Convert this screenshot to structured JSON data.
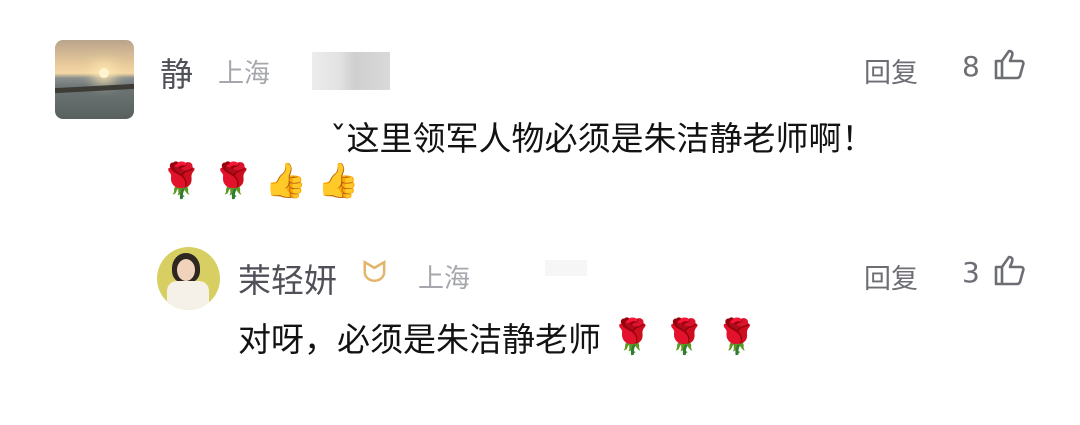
{
  "comment": {
    "username": "静",
    "location": "上海",
    "text": "这里领军人物必须是朱洁静老师啊！",
    "prefix": "ˇ",
    "emojis": [
      "🌹",
      "🌹",
      "👍",
      "👍"
    ],
    "reply_label": "回复",
    "like_count": "8"
  },
  "reply": {
    "username": "茉轻妍",
    "badge": "ᗢ",
    "location": "上海",
    "text": "对呀，必须是朱洁静老师",
    "emojis": [
      "🌹",
      "🌹",
      "🌹"
    ],
    "reply_label": "回复",
    "like_count": "3"
  },
  "colors": {
    "username": "#4f5058",
    "meta": "#a6a7ac",
    "text": "#121212",
    "badge": "#e2b56a"
  }
}
